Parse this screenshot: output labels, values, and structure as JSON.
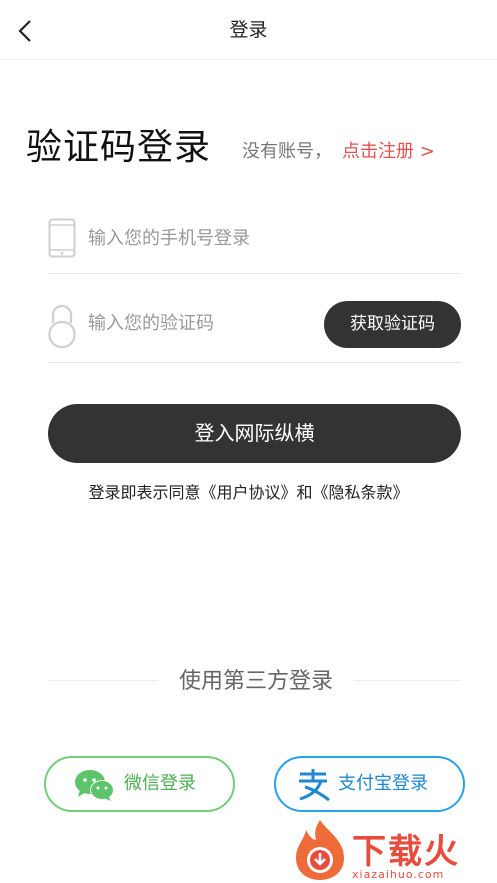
{
  "navbar": {
    "title": "登录",
    "back_icon": "chevron-left-icon"
  },
  "heading": {
    "title": "验证码登录",
    "no_account": "没有账号，",
    "register_link": "点击注册 >"
  },
  "form": {
    "phone": {
      "icon": "phone-icon",
      "placeholder": "输入您的手机号登录",
      "value": ""
    },
    "code": {
      "icon": "lock-icon",
      "placeholder": "输入您的验证码",
      "value": "",
      "get_code_label": "获取验证码"
    },
    "login_button": "登入网际纵横",
    "agreement": {
      "prefix": "登录即表示同意",
      "user_agreement": "《用户协议》",
      "and": "和",
      "privacy": "《隐私条款》"
    }
  },
  "third_party": {
    "label": "使用第三方登录",
    "wechat": {
      "label": "微信登录",
      "icon": "wechat-icon",
      "color": "#4caf50"
    },
    "alipay": {
      "label": "支付宝登录",
      "icon": "alipay-icon",
      "color": "#1e88d2"
    }
  },
  "watermark": {
    "text": "下载火",
    "subtext": "xiazaihuo.com",
    "icon": "flame-logo-icon",
    "color": "#e84c3d"
  },
  "colors": {
    "dark_button": "#333333",
    "accent_red": "#e0524f"
  }
}
